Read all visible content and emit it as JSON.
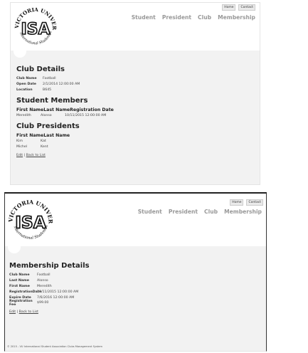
{
  "logo": {
    "top_text": "VICTORIA UNIVERSITY",
    "initials": "ISA",
    "bottom_text": "International Student Association"
  },
  "utility_nav": [
    "Home",
    "Contact"
  ],
  "main_nav": [
    "Student",
    "President",
    "Club",
    "Membership"
  ],
  "page1": {
    "title": "Club Details",
    "fields": [
      {
        "label": "Club Name",
        "value": "Football"
      },
      {
        "label": "Open Date",
        "value": "2/1/2014 12:00:00 AM"
      },
      {
        "label": "Location",
        "value": "B645"
      }
    ],
    "members": {
      "title": "Student Members",
      "headers": [
        "First Name",
        "Last Name",
        "Registration Date"
      ],
      "rows": [
        [
          "Meredith",
          "Alonso",
          "10/11/2015 12:00:00 AM"
        ]
      ]
    },
    "presidents": {
      "title": "Club Presidents",
      "headers": [
        "First Name",
        "Last Name"
      ],
      "rows": [
        [
          "Kim",
          "Kat"
        ],
        [
          "Michel",
          "Kent"
        ]
      ]
    },
    "links": [
      "Edit",
      "Back to List"
    ]
  },
  "page2": {
    "title": "Membership Details",
    "fields": [
      {
        "label": "Club Name",
        "value": "Football"
      },
      {
        "label": "Last Name",
        "value": "Alonso"
      },
      {
        "label": "First Name",
        "value": "Meredith"
      },
      {
        "label": "RegistrationDate",
        "value": "10/11/2015 12:00:00 AM"
      },
      {
        "label": "Expire Date",
        "value": "7/6/2016 12:00:00 AM"
      },
      {
        "label": "Registration Fee",
        "value": "$99.00"
      }
    ],
    "links": [
      "Edit",
      "Back to List"
    ],
    "footer": "© 2015 - VU International Student Association Clubs Management System"
  }
}
